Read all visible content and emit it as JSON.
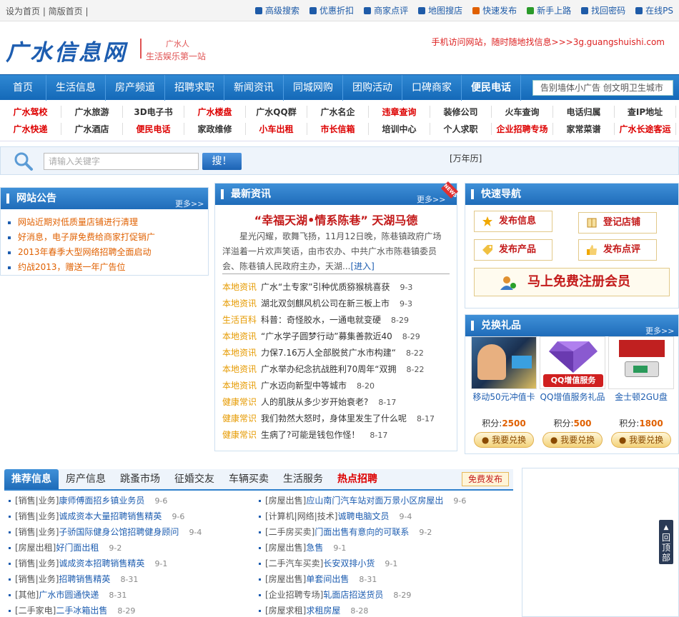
{
  "topbar": {
    "left": "设为首页 | 简版首页 |",
    "links": [
      {
        "label": "高级搜索",
        "icon": "search-icon",
        "color": "#1e5ba8"
      },
      {
        "label": "优惠折扣",
        "icon": "discount-icon",
        "color": "#1e5ba8"
      },
      {
        "label": "商家点评",
        "icon": "comment-icon",
        "color": "#1e5ba8"
      },
      {
        "label": "地图搜店",
        "icon": "map-icon",
        "color": "#1e5ba8"
      },
      {
        "label": "快速发布",
        "icon": "publish-icon",
        "color": "#e06000"
      },
      {
        "label": "新手上路",
        "icon": "help-icon",
        "color": "#2a9a2a"
      },
      {
        "label": "找回密码",
        "icon": "key-icon",
        "color": "#1e5ba8"
      },
      {
        "label": "在线PS",
        "icon": "ps-icon",
        "color": "#1e5ba8"
      }
    ]
  },
  "header": {
    "logo": "广水信息网",
    "slogan_top": "广水人",
    "slogan_bottom": "生活娱乐第一站",
    "mobile": "手机访问网站，随时随地找信息>>>3g.guangshuishi.com"
  },
  "nav": {
    "items": [
      "首页",
      "生活信息",
      "房产频道",
      "招聘求职",
      "新闻资讯",
      "同城网购",
      "团购活动",
      "口碑商家",
      "便民电话"
    ],
    "ad": "告别墙体小广告 创文明卫生城市"
  },
  "quick_links": {
    "row1": [
      {
        "label": "广水驾校",
        "red": true
      },
      {
        "label": "广水旅游",
        "red": false
      },
      {
        "label": "3D电子书",
        "red": false
      },
      {
        "label": "广水楼盘",
        "red": true
      },
      {
        "label": "广水QQ群",
        "red": false
      },
      {
        "label": "广水名企",
        "red": false
      },
      {
        "label": "违章查询",
        "red": true
      },
      {
        "label": "装修公司",
        "red": false
      },
      {
        "label": "火车查询",
        "red": false
      },
      {
        "label": "电话归属",
        "red": false
      },
      {
        "label": "查IP地址",
        "red": false
      }
    ],
    "row2": [
      {
        "label": "广水快递",
        "red": true
      },
      {
        "label": "广水酒店",
        "red": false
      },
      {
        "label": "便民电话",
        "red": true
      },
      {
        "label": "家政维修",
        "red": false
      },
      {
        "label": "小车出租",
        "red": true
      },
      {
        "label": "市长信箱",
        "red": true
      },
      {
        "label": "培训中心",
        "red": false
      },
      {
        "label": "个人求职",
        "red": false
      },
      {
        "label": "企业招聘专场",
        "red": true
      },
      {
        "label": "家常菜谱",
        "red": false
      },
      {
        "label": "广水长途客运",
        "red": true
      }
    ]
  },
  "search": {
    "placeholder": "请输入关键字",
    "button": "搜！",
    "calendar": "[万年历]"
  },
  "notice": {
    "title": "网站公告",
    "more": "更多>>",
    "items": [
      "网站近期对低质量店铺进行清理",
      "好消息，电子屏免费给商家打促销广",
      "2013年春季大型网络招聘全面启动",
      "约战2013，赠送一年广告位"
    ]
  },
  "news": {
    "title": "最新资讯",
    "more": "更多>>",
    "badge": "NEWS",
    "headline": "“幸福天湖•情系陈巷” 天湖马德",
    "summary": "星光闪耀，歌舞飞扬，11月12日晚，陈巷镇政府广场洋溢着一片欢声笑语，由市农办、中共广水市陈巷镇委员会、陈巷镇人民政府主办，天湖...",
    "enter": "[进入]",
    "items": [
      {
        "cat": "本地资讯",
        "title": "广水“土专家”引种优质猕猴桃喜获",
        "date": "9-3"
      },
      {
        "cat": "本地资讯",
        "title": "湖北双剑麒风机公司在新三板上市",
        "date": "9-3"
      },
      {
        "cat": "生活百科",
        "title": "科普：奇怪胶水，一通电就变硬",
        "date": "8-29"
      },
      {
        "cat": "本地资讯",
        "title": "“广水学子圆梦行动”募集善款近40",
        "date": "8-29"
      },
      {
        "cat": "本地资讯",
        "title": "力保7.16万人全部脱贫广水市构建“",
        "date": "8-22"
      },
      {
        "cat": "本地资讯",
        "title": "广水举办纪念抗战胜利70周年“双拥",
        "date": "8-22"
      },
      {
        "cat": "本地资讯",
        "title": "广水迈向新型中等城市",
        "date": "8-20"
      },
      {
        "cat": "健康常识",
        "title": "人的肌肤从多少岁开始衰老?",
        "date": "8-17"
      },
      {
        "cat": "健康常识",
        "title": "我们勃然大怒时，身体里发生了什么呢",
        "date": "8-17"
      },
      {
        "cat": "健康常识",
        "title": "生病了?可能是钱包作怪！",
        "date": "8-17"
      }
    ]
  },
  "quicknav": {
    "title": "快速导航",
    "buttons": [
      {
        "label": "发布信息",
        "icon": "star-icon"
      },
      {
        "label": "登记店铺",
        "icon": "book-icon"
      },
      {
        "label": "发布产品",
        "icon": "tag-icon"
      },
      {
        "label": "发布点评",
        "icon": "thumb-icon"
      }
    ],
    "register": "马上免费注册会员"
  },
  "gifts": {
    "title": "兑换礼品",
    "more": "更多>>",
    "items": [
      {
        "name": "移动50元冲值卡",
        "points_label": "积分:",
        "points": "2500",
        "button": "我要兑换"
      },
      {
        "name": "QQ增值服务礼品",
        "points_label": "积分:",
        "points": "500",
        "button": "我要兑换"
      },
      {
        "name": "金士顿2GU盘",
        "points_label": "积分:",
        "points": "1800",
        "button": "我要兑换"
      }
    ],
    "qq_text": "QQ增值服务"
  },
  "classifieds": {
    "tabs": [
      "推荐信息",
      "房产信息",
      "跳蚤市场",
      "征婚交友",
      "车辆买卖",
      "生活服务",
      "热点招聘"
    ],
    "free_post": "免费发布",
    "left": [
      {
        "cat": "[销售|业务]",
        "title": "康师傅面招乡镇业务员",
        "date": "9-6"
      },
      {
        "cat": "[销售|业务]",
        "title": "诚成资本大量招聘销售精英",
        "date": "9-6"
      },
      {
        "cat": "[销售|业务]",
        "title": "子骄国际健身公馆招聘健身顾问",
        "date": "9-4"
      },
      {
        "cat": "[房屋出租]",
        "title": "好门面出租",
        "date": "9-2"
      },
      {
        "cat": "[销售|业务]",
        "title": "诚成资本招聘销售精英",
        "date": "9-1"
      },
      {
        "cat": "[销售|业务]",
        "title": "招聘销售精英",
        "date": "8-31"
      },
      {
        "cat": "[其他]",
        "title": "广水市圆通快递",
        "date": "8-31"
      },
      {
        "cat": "[二手家电]",
        "title": "二手冰箱出售",
        "date": "8-29"
      }
    ],
    "right": [
      {
        "cat": "[房屋出售]",
        "title": "应山南门汽车站对面万景小区房屋出",
        "date": "9-6"
      },
      {
        "cat": "[计算机|网络|技术]",
        "title": "诚聘电脑文员",
        "date": "9-4"
      },
      {
        "cat": "[二手房买卖]",
        "title": "门面出售有意向的可联系",
        "date": "9-2"
      },
      {
        "cat": "[房屋出售]",
        "title": "急售",
        "date": "9-1"
      },
      {
        "cat": "[二手汽车买卖]",
        "title": "长安双排小货",
        "date": "9-1"
      },
      {
        "cat": "[房屋出售]",
        "title": "单套间出售",
        "date": "8-31"
      },
      {
        "cat": "[企业招聘专场]",
        "title": "轧面店招送货员",
        "date": "8-29"
      },
      {
        "cat": "[房屋求租]",
        "title": "求租房屋",
        "date": "8-28"
      }
    ]
  },
  "totop": "回顶部"
}
